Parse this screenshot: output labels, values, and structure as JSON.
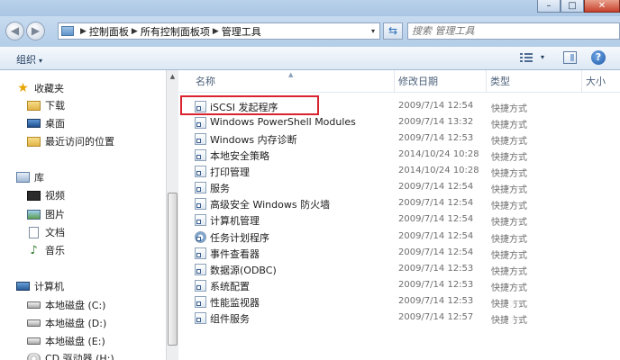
{
  "window": {
    "controls": {
      "minimize": "–",
      "maximize": "□",
      "close": "✕"
    }
  },
  "address_bar": {
    "crumbs": [
      "控制面板",
      "所有控制面板项",
      "管理工具"
    ],
    "separator": "▶",
    "dropdown": "▾"
  },
  "search": {
    "placeholder": "搜索 管理工具"
  },
  "toolbar": {
    "organize_label": "组织",
    "organize_arrow": "▾",
    "view_dropdown": "▾",
    "help_label": "?"
  },
  "nav": {
    "items": [
      {
        "label": "收藏夹",
        "icon": "star-icon"
      },
      {
        "label": "下载",
        "icon": "folder-icon"
      },
      {
        "label": "桌面",
        "icon": "desktop-icon"
      },
      {
        "label": "最近访问的位置",
        "icon": "recent-icon"
      },
      {
        "label": "库",
        "icon": "library-icon"
      },
      {
        "label": "视频",
        "icon": "video-icon"
      },
      {
        "label": "图片",
        "icon": "pictures-icon"
      },
      {
        "label": "文档",
        "icon": "documents-icon"
      },
      {
        "label": "音乐",
        "icon": "music-icon"
      },
      {
        "label": "计算机",
        "icon": "computer-icon"
      },
      {
        "label": "本地磁盘 (C:)",
        "icon": "disk-icon"
      },
      {
        "label": "本地磁盘 (D:)",
        "icon": "disk-icon"
      },
      {
        "label": "本地磁盘 (E:)",
        "icon": "disk-icon"
      },
      {
        "label": "CD 驱动器 (H:)",
        "icon": "cd-icon"
      }
    ]
  },
  "columns": {
    "name": "名称",
    "date": "修改日期",
    "type": "类型",
    "size": "大小"
  },
  "files": [
    {
      "name": "iSCSI 发起程序",
      "date": "2009/7/14 12:54",
      "type": "快捷方式"
    },
    {
      "name": "Windows PowerShell Modules",
      "date": "2009/7/14 13:32",
      "type": "快捷方式"
    },
    {
      "name": "Windows 内存诊断",
      "date": "2009/7/14 12:53",
      "type": "快捷方式"
    },
    {
      "name": "本地安全策略",
      "date": "2014/10/24 10:28",
      "type": "快捷方式"
    },
    {
      "name": "打印管理",
      "date": "2014/10/24 10:28",
      "type": "快捷方式"
    },
    {
      "name": "服务",
      "date": "2009/7/14 12:54",
      "type": "快捷方式"
    },
    {
      "name": "高级安全 Windows 防火墙",
      "date": "2009/7/14 12:54",
      "type": "快捷方式"
    },
    {
      "name": "计算机管理",
      "date": "2009/7/14 12:54",
      "type": "快捷方式"
    },
    {
      "name": "任务计划程序",
      "date": "2009/7/14 12:54",
      "type": "快捷方式"
    },
    {
      "name": "事件查看器",
      "date": "2009/7/14 12:54",
      "type": "快捷方式"
    },
    {
      "name": "数据源(ODBC)",
      "date": "2009/7/14 12:53",
      "type": "快捷方式"
    },
    {
      "name": "系统配置",
      "date": "2009/7/14 12:53",
      "type": "快捷方式"
    },
    {
      "name": "性能监视器",
      "date": "2009/7/14 12:53",
      "type": "快捷方式"
    },
    {
      "name": "组件服务",
      "date": "2009/7/14 12:57",
      "type": "快捷方式"
    }
  ],
  "highlight_color": "#d9232e"
}
